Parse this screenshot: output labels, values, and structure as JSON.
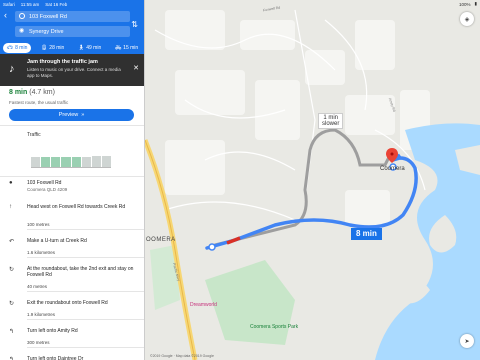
{
  "status_bar": {
    "carrier": "Safari",
    "time": "11:55 am",
    "date": "Sat 16 Feb",
    "battery": "100%"
  },
  "directions": {
    "origin": "103 Foxwell Rd",
    "destination": "Synergy Drive",
    "modes": [
      {
        "icon": "car-icon",
        "label": "8 min",
        "active": true
      },
      {
        "icon": "transit-icon",
        "label": "28 min",
        "active": false
      },
      {
        "icon": "walk-icon",
        "label": "49 min",
        "active": false
      },
      {
        "icon": "bike-icon",
        "label": "15 min",
        "active": false
      }
    ]
  },
  "banner": {
    "title": "Jam through the traffic jam",
    "description": "Listen to music on your drive. Connect a media app to Maps."
  },
  "summary": {
    "time": "8 min",
    "distance": "(4.7 km)",
    "fastest": "Fastest route, the usual traffic",
    "preview_label": "Preview"
  },
  "traffic": {
    "label": "Traffic",
    "bars": [
      0.45,
      0.45,
      0.45,
      0.45,
      0.45,
      0.45,
      0.5,
      0.5
    ]
  },
  "steps": [
    {
      "icon": "pin-icon",
      "text": "103 Foxwell Rd",
      "sub": "Coomera QLD 4209"
    },
    {
      "icon": "arrow-up-icon",
      "text": "Head west on Foxwell Rd towards Creek Rd",
      "distance": "100 metres"
    },
    {
      "icon": "u-turn-icon",
      "text": "Make a U-turn at Creek Rd",
      "distance": "1.6 kilometres"
    },
    {
      "icon": "roundabout-icon",
      "text": "At the roundabout, take the 2nd exit and stay on Foxwell Rd",
      "distance": "40 metres"
    },
    {
      "icon": "roundabout-icon",
      "text": "Exit the roundabout onto Foxwell Rd",
      "distance": "1.9 kilometres"
    },
    {
      "icon": "turn-left-icon",
      "text": "Turn left onto Amity Rd",
      "distance": "300 metres"
    },
    {
      "icon": "turn-left-icon",
      "text": "Turn left onto Daintree Dr",
      "distance": ""
    }
  ],
  "map": {
    "main_route_time": "8 min",
    "alt_route_time": "1 min",
    "alt_route_note": "slower",
    "places": {
      "coomera": "Coomera",
      "coomera_sw": "OOMERA",
      "dreamworld": "Dreamworld",
      "sports_park": "Coomera Sports Park"
    },
    "roads": {
      "pacific_mwy": "Pacific Mwy",
      "foxwell": "Foxwell Rd",
      "amity": "Amity Rd"
    },
    "copyright": "©2019 Google · Map data ©2019 Google"
  },
  "colors": {
    "accent": "#1a73e8",
    "route": "#4285f4",
    "time_green": "#188038",
    "water": "#aadaff",
    "park": "#c8e6c9"
  }
}
